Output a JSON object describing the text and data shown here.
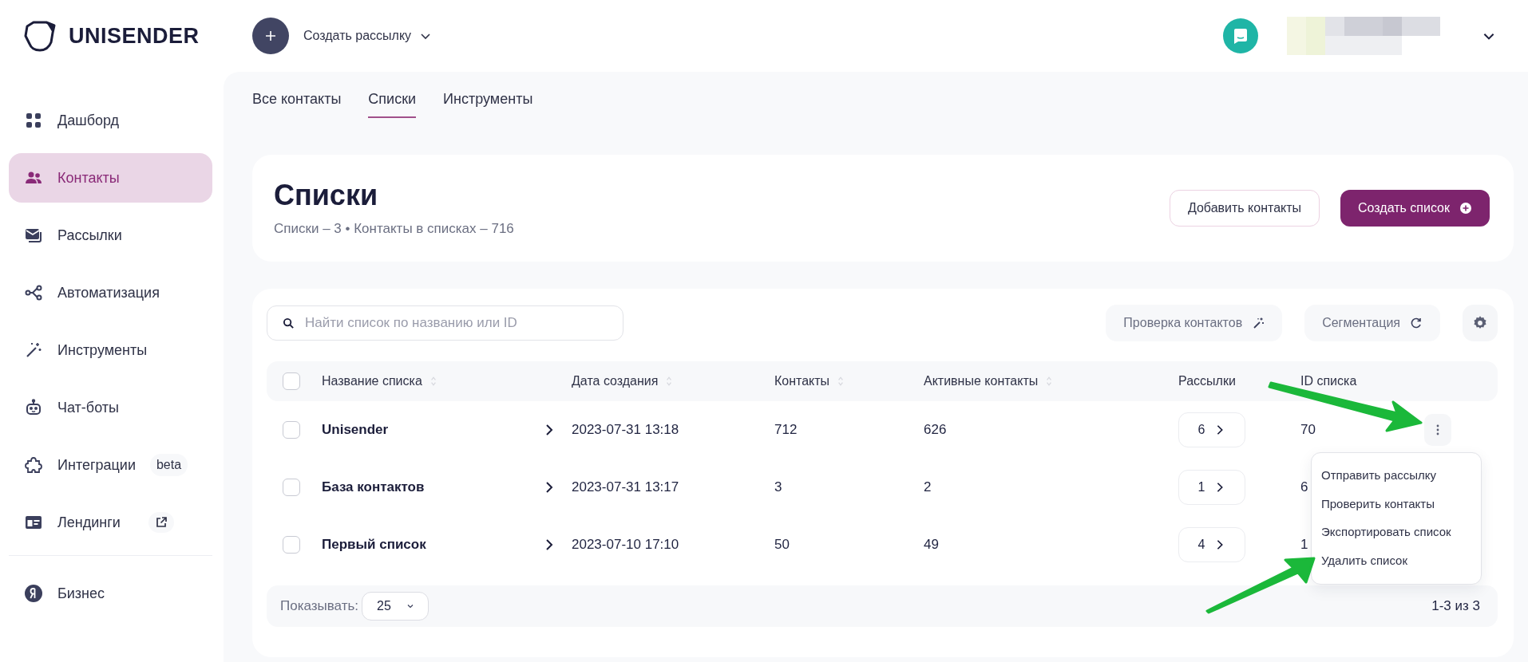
{
  "brand": {
    "name": "UNISENDER"
  },
  "top_bar": {
    "create_label": "Создать рассылку"
  },
  "sidebar": {
    "items": [
      {
        "label": "Дашборд",
        "kind": "dashboard",
        "selected": false
      },
      {
        "label": "Контакты",
        "kind": "contacts",
        "selected": true
      },
      {
        "label": "Рассылки",
        "kind": "mailings",
        "selected": false
      },
      {
        "label": "Автоматизация",
        "kind": "automation",
        "selected": false
      },
      {
        "label": "Инструменты",
        "kind": "tools",
        "selected": false
      },
      {
        "label": "Чат-боты",
        "kind": "chatbots",
        "selected": false
      },
      {
        "label": "Интеграции",
        "kind": "integrations",
        "selected": false,
        "badge": "beta"
      },
      {
        "label": "Лендинги",
        "kind": "landings",
        "selected": false,
        "external": true
      }
    ],
    "bottom_items": [
      {
        "label": "Бизнес",
        "kind": "business",
        "selected": false
      }
    ]
  },
  "tabs": [
    {
      "label": "Все контакты",
      "selected": false
    },
    {
      "label": "Списки",
      "selected": true
    },
    {
      "label": "Инструменты",
      "selected": false
    }
  ],
  "header": {
    "title": "Списки",
    "summary": "Списки – 3 • Контакты в списках – 716",
    "buttons": [
      {
        "label": "Добавить контакты",
        "kind": "secondary"
      },
      {
        "label": "Создать список",
        "kind": "primary"
      }
    ]
  },
  "search": {
    "placeholder": "Найти список по названию или ID"
  },
  "tools": [
    {
      "label": "Проверка контактов",
      "kind": "wand"
    },
    {
      "label": "Сегментация",
      "kind": "refresh"
    }
  ],
  "table": {
    "all_checked": false,
    "columns": [
      {
        "label": "Название списка",
        "sortable": true
      },
      {
        "label": "Дата создания",
        "sortable": true
      },
      {
        "label": "Контакты",
        "sortable": true
      },
      {
        "label": "Активные контакты",
        "sortable": true
      },
      {
        "label": "Рассылки",
        "sortable": false
      },
      {
        "label": "ID списка",
        "sortable": false
      }
    ],
    "rows": [
      {
        "checked": false,
        "name": "Unisender",
        "date": "2023-07-31 13:18",
        "contacts": "712",
        "active": "626",
        "mailings": "6",
        "id": "70"
      },
      {
        "checked": false,
        "name": "База контактов",
        "date": "2023-07-31 13:17",
        "contacts": "3",
        "active": "2",
        "mailings": "1",
        "id": "6"
      },
      {
        "checked": false,
        "name": "Первый список",
        "date": "2023-07-10 17:10",
        "contacts": "50",
        "active": "49",
        "mailings": "4",
        "id": "1"
      }
    ]
  },
  "row_menu": {
    "items": [
      "Отправить рассылку",
      "Проверить контакты",
      "Экспортировать список",
      "Удалить список"
    ]
  },
  "footer": {
    "show_label": "Показывать:",
    "page_size": "25",
    "range": "1-3 из 3"
  }
}
